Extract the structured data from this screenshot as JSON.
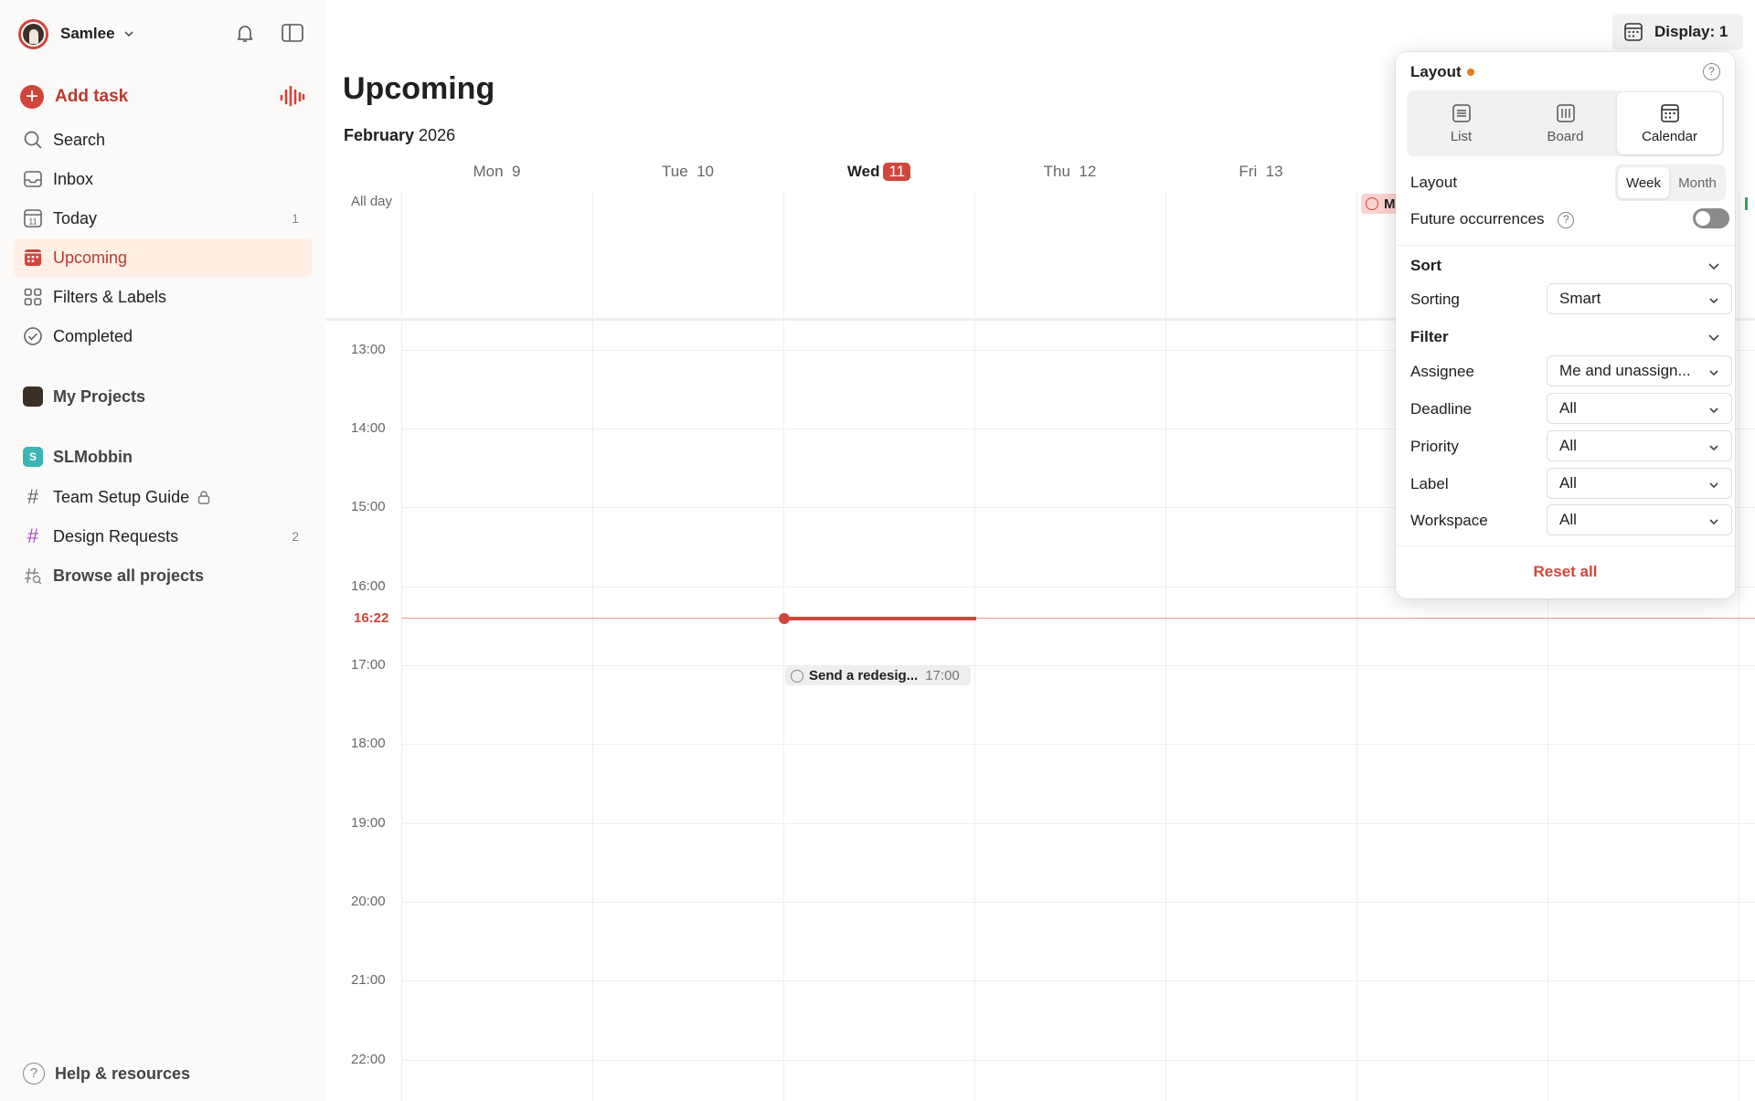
{
  "user": {
    "name": "Samlee"
  },
  "sidebar": {
    "add_task": "Add task",
    "items": [
      {
        "label": "Search",
        "icon": "search-icon"
      },
      {
        "label": "Inbox",
        "icon": "inbox-icon"
      },
      {
        "label": "Today",
        "icon": "calendar-today-icon",
        "count": "1"
      },
      {
        "label": "Upcoming",
        "icon": "calendar-upcoming-icon"
      },
      {
        "label": "Filters & Labels",
        "icon": "grid-icon"
      },
      {
        "label": "Completed",
        "icon": "check-circle-icon"
      }
    ],
    "my_projects": "My Projects",
    "workspace": {
      "initial": "S",
      "name": "SLMobbin"
    },
    "projects": [
      {
        "label": "Team Setup Guide",
        "locked": true
      },
      {
        "label": "Design Requests",
        "count": "2"
      }
    ],
    "browse": "Browse all projects",
    "help": "Help & resources"
  },
  "main": {
    "title": "Upcoming",
    "month": "February",
    "year": "2026",
    "display_button": "Display: 1",
    "days": [
      {
        "label": "Mon  9"
      },
      {
        "label": "Tue  10"
      },
      {
        "label": "Wed",
        "badge": "11",
        "today": true
      },
      {
        "label": "Thu  12"
      },
      {
        "label": "Fri  13"
      }
    ],
    "all_day": "All day",
    "allday_task": "M",
    "hours": [
      "13:00",
      "14:00",
      "15:00",
      "16:00",
      "17:00",
      "18:00",
      "19:00",
      "20:00",
      "21:00",
      "22:00"
    ],
    "now": "16:22",
    "event": {
      "title": "Send a redesig...",
      "time": "17:00"
    }
  },
  "popover": {
    "layout_title": "Layout",
    "views": [
      "List",
      "Board",
      "Calendar"
    ],
    "active_view": "Calendar",
    "layout_label": "Layout",
    "week": "Week",
    "month": "Month",
    "future_occurrences": "Future occurrences",
    "future_occurrences_on": false,
    "sort_title": "Sort",
    "sorting_label": "Sorting",
    "sorting_value": "Smart",
    "filter_title": "Filter",
    "filters": [
      {
        "label": "Assignee",
        "value": "Me and unassign..."
      },
      {
        "label": "Deadline",
        "value": "All"
      },
      {
        "label": "Priority",
        "value": "All"
      },
      {
        "label": "Label",
        "value": "All"
      },
      {
        "label": "Workspace",
        "value": "All"
      }
    ],
    "reset": "Reset all"
  },
  "colors": {
    "accent": "#d1453b",
    "active_bg": "#ffefe5",
    "sidebar_bg": "#fcfaf8",
    "pending_dot": "#e77a18"
  }
}
